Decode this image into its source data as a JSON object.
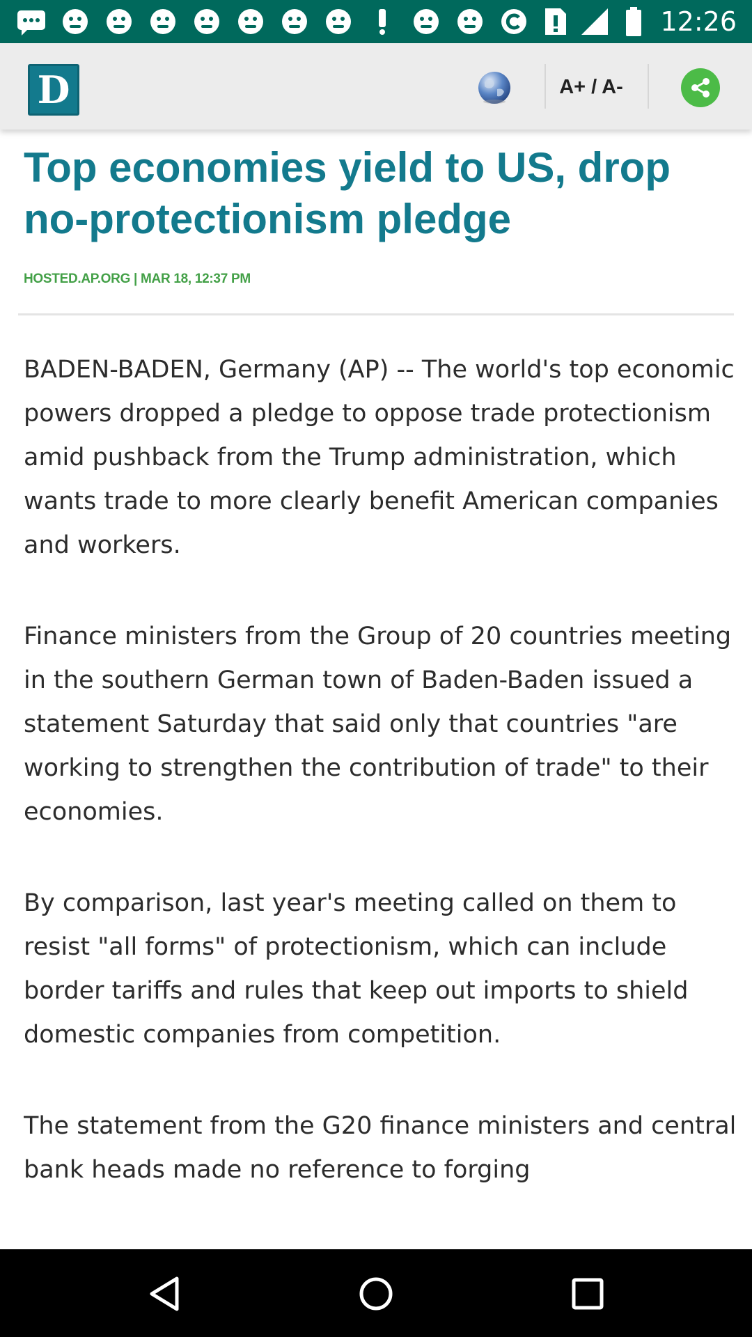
{
  "status_bar": {
    "time": "12:26",
    "left_icons": [
      "messaging-icon",
      "notification-icon",
      "notification-icon",
      "notification-icon",
      "notification-icon",
      "notification-icon",
      "notification-icon",
      "notification-icon",
      "exclamation-icon",
      "notification-icon",
      "notification-icon",
      "sync-icon"
    ],
    "right_icons": [
      "no-sim-icon",
      "signal-icon",
      "battery-icon"
    ]
  },
  "toolbar": {
    "logo_letter": "D",
    "font_size_label": "A+ / A-",
    "globe_icon": "globe-icon",
    "share_icon": "share-icon"
  },
  "article": {
    "headline": "Top economies yield to US, drop no-protectionism pledge",
    "meta": "HOSTED.AP.ORG | MAR 18, 12:37 PM",
    "paragraphs": [
      "BADEN-BADEN, Germany (AP) -- The world's top economic powers dropped a pledge to oppose trade protectionism amid pushback from the Trump administration, which wants trade to more clearly benefit American companies and workers.",
      "Finance ministers from the Group of 20 countries meeting in the southern German town of Baden-Baden issued a statement Saturday that said only that countries \"are working to strengthen the contribution of trade\" to their economies.",
      "By comparison, last year's meeting called on them to resist \"all forms\" of protectionism, which can include border tariffs and rules that keep out imports to shield domestic companies from competition.",
      "The statement from the G20 finance ministers and central bank heads made no reference to forging"
    ]
  },
  "nav_bar": {
    "buttons": [
      "back-icon",
      "home-icon",
      "recents-icon"
    ]
  },
  "colors": {
    "status_bar": "#00695c",
    "headline": "#137a8d",
    "meta": "#43a047",
    "share": "#4cbb47"
  }
}
